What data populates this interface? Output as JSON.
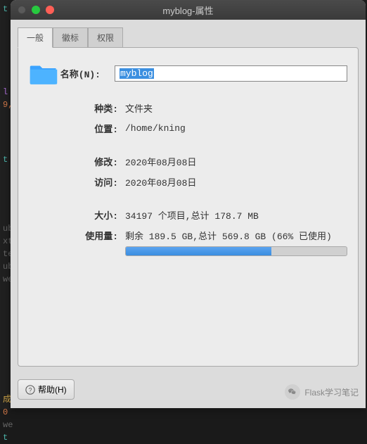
{
  "window": {
    "title": "myblog-属性"
  },
  "tabs": {
    "general": "一般",
    "emblems": "徽标",
    "permissions": "权限"
  },
  "fields": {
    "name_label": "名称(N):",
    "name_value": "myblog",
    "kind_label": "种类:",
    "kind_value": "文件夹",
    "location_label": "位置:",
    "location_value": "/home/kning",
    "modified_label": "修改:",
    "modified_value": "2020年08月08日",
    "accessed_label": "访问:",
    "accessed_value": "2020年08月08日",
    "size_label": "大小:",
    "size_value": "34197 个项目,总计 178.7 MB",
    "usage_label": "使用量:",
    "usage_value": "剩余 189.5 GB,总计 569.8 GB (66% 已使用)",
    "usage_percent": 66
  },
  "footer": {
    "help_label": "帮助(H)"
  },
  "watermark": {
    "text": "Flask学习笔记"
  }
}
